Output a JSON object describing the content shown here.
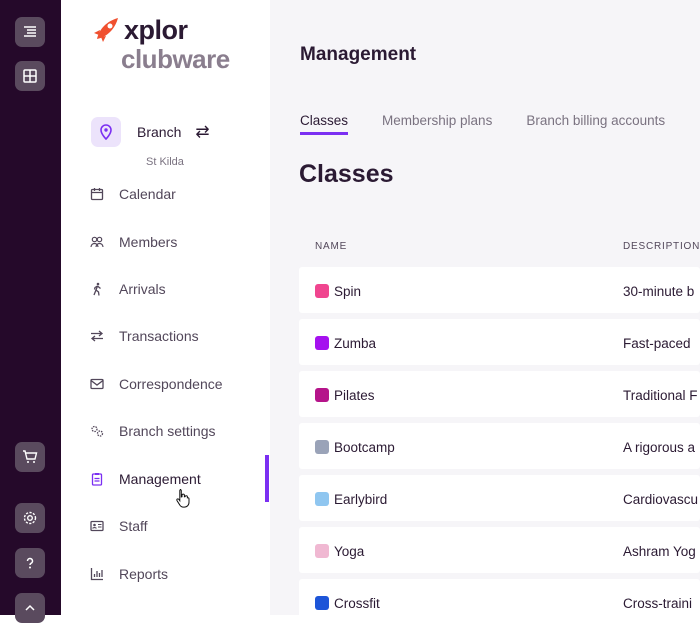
{
  "brand": {
    "line1": "xplor",
    "line2": "clubware"
  },
  "rail": {
    "top_icons": [
      "menu-icon",
      "grid-icon"
    ],
    "bottom_icons": [
      "cart-icon",
      "settings-icon",
      "help-icon",
      "partial-icon"
    ]
  },
  "branch": {
    "label": "Branch",
    "name": "St Kilda",
    "swap_icon": "swap-icon"
  },
  "nav": [
    {
      "label": "Calendar",
      "icon": "calendar-icon"
    },
    {
      "label": "Members",
      "icon": "members-icon"
    },
    {
      "label": "Arrivals",
      "icon": "walk-icon"
    },
    {
      "label": "Transactions",
      "icon": "arrows-icon"
    },
    {
      "label": "Correspondence",
      "icon": "mail-icon"
    },
    {
      "label": "Branch settings",
      "icon": "gears-icon"
    },
    {
      "label": "Management",
      "icon": "clipboard-icon",
      "active": true
    },
    {
      "label": "Staff",
      "icon": "id-card-icon"
    },
    {
      "label": "Reports",
      "icon": "chart-icon"
    }
  ],
  "page": {
    "title": "Management",
    "tabs": [
      "Classes",
      "Membership plans",
      "Branch billing accounts"
    ],
    "active_tab": "Classes",
    "section_title": "Classes"
  },
  "table": {
    "headers": [
      "NAME",
      "DESCRIPTION"
    ],
    "rows": [
      {
        "name": "Spin",
        "color": "#f0458f",
        "desc": "30-minute b"
      },
      {
        "name": "Zumba",
        "color": "#a511ef",
        "desc": "Fast-paced"
      },
      {
        "name": "Pilates",
        "color": "#b5148a",
        "desc": "Traditional F"
      },
      {
        "name": "Bootcamp",
        "color": "#9aa3b8",
        "desc": "A rigorous a"
      },
      {
        "name": "Earlybird",
        "color": "#8fc6f0",
        "desc": "Cardiovascu"
      },
      {
        "name": "Yoga",
        "color": "#f0b8d2",
        "desc": "Ashram Yog"
      },
      {
        "name": "Crossfit",
        "color": "#1d55d8",
        "desc": "Cross-traini"
      }
    ]
  },
  "colors": {
    "accent": "#7b2ff2",
    "rail": "#25092a",
    "brand_orange": "#f0502f"
  }
}
